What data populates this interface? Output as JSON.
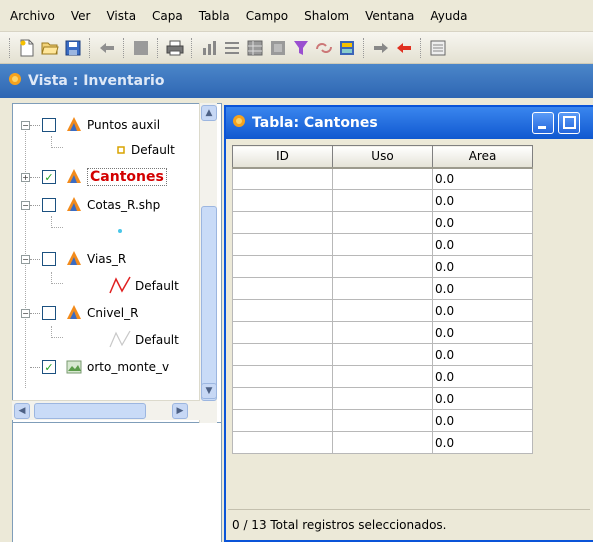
{
  "menubar": {
    "items": [
      "Archivo",
      "Ver",
      "Vista",
      "Capa",
      "Tabla",
      "Campo",
      "Shalom",
      "Ventana",
      "Ayuda"
    ]
  },
  "toolbar": {
    "icons": [
      "new-icon",
      "open-icon",
      "save-icon",
      "back-icon",
      "layer-icon",
      "print-icon",
      "chart-icon",
      "list-icon",
      "table-icon",
      "layers-icon",
      "filter-icon",
      "link-icon",
      "graph-icon",
      "forward-arrow-icon",
      "red-arrow-icon",
      "map-icon"
    ]
  },
  "vista": {
    "title": "Vista : Inventario"
  },
  "toc": {
    "layers": [
      {
        "name": "Puntos auxil",
        "checked": false,
        "legend": "Default"
      },
      {
        "name": "Cantones",
        "checked": true,
        "selected": true
      },
      {
        "name": "Cotas_R.shp",
        "checked": false
      },
      {
        "name": "Vias_R",
        "checked": false,
        "legend": "Default"
      },
      {
        "name": "Cnivel_R",
        "checked": false,
        "legend": "Default"
      },
      {
        "name": "orto_monte_v",
        "checked": true
      }
    ]
  },
  "tabla": {
    "title": "Tabla: Cantones",
    "columns": [
      "ID",
      "Uso",
      "Area"
    ],
    "rows": [
      [
        "",
        "",
        "0.0"
      ],
      [
        "",
        "",
        "0.0"
      ],
      [
        "",
        "",
        "0.0"
      ],
      [
        "",
        "",
        "0.0"
      ],
      [
        "",
        "",
        "0.0"
      ],
      [
        "",
        "",
        "0.0"
      ],
      [
        "",
        "",
        "0.0"
      ],
      [
        "",
        "",
        "0.0"
      ],
      [
        "",
        "",
        "0.0"
      ],
      [
        "",
        "",
        "0.0"
      ],
      [
        "",
        "",
        "0.0"
      ],
      [
        "",
        "",
        "0.0"
      ],
      [
        "",
        "",
        "0.0"
      ]
    ],
    "status": "0 / 13 Total registros seleccionados."
  },
  "colors": {
    "titlebar_active": "#1058d0",
    "titlebar_inactive": "#2e66b3",
    "selected_layer": "#d30000"
  }
}
